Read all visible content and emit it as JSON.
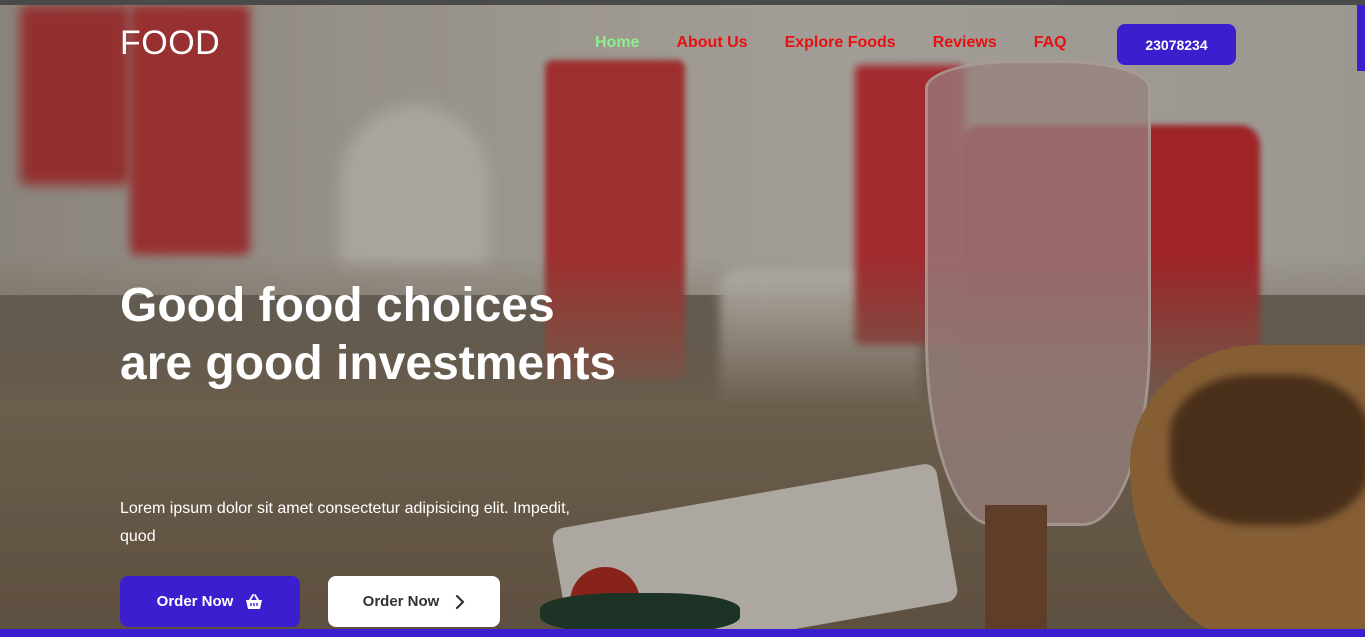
{
  "header": {
    "logo": "FOOD",
    "nav": [
      {
        "label": "Home",
        "active": true
      },
      {
        "label": "About Us",
        "active": false
      },
      {
        "label": "Explore Foods",
        "active": false
      },
      {
        "label": "Reviews",
        "active": false
      },
      {
        "label": "FAQ",
        "active": false
      }
    ],
    "id_button": "23078234"
  },
  "hero": {
    "headline": "Good food choices are good investments",
    "description": "Lorem ipsum dolor sit amet consectetur adipisicing elit. Impedit, quod",
    "primary_button": {
      "label": "Order Now",
      "icon": "basket-icon"
    },
    "secondary_button": {
      "label": "Order Now",
      "icon": "chevron-right-icon"
    }
  },
  "colors": {
    "accent": "#3b1fcf",
    "nav_link": "#e81010",
    "nav_active": "#8ef08a",
    "text_light": "#ffffff"
  }
}
